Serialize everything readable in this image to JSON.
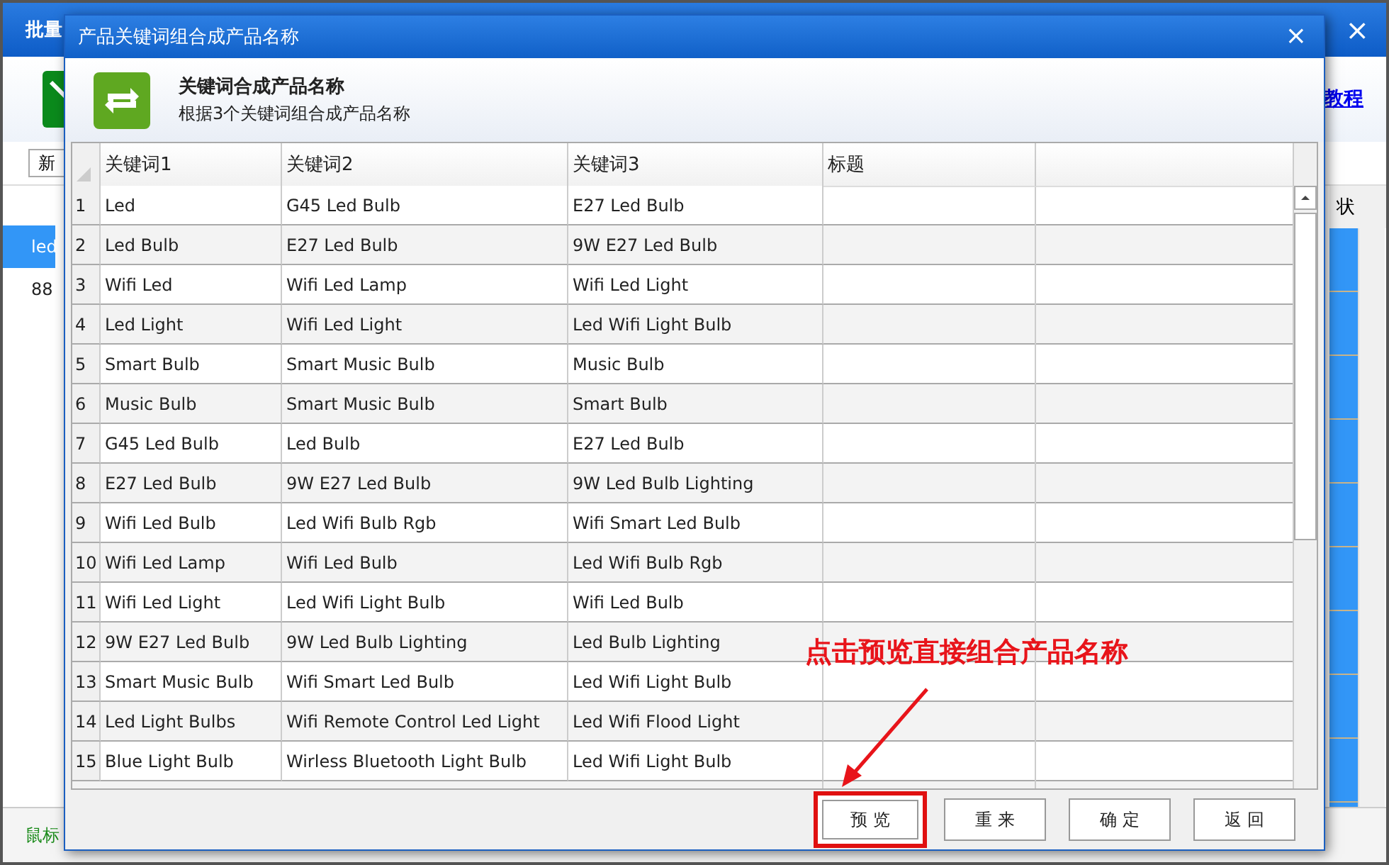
{
  "background_window": {
    "title": "批量",
    "close": "×",
    "toolbar_link": "教程",
    "search_value": "新",
    "list_items": [
      {
        "text": "led",
        "selected": true
      },
      {
        "text": "88",
        "selected": false
      }
    ],
    "table_column": "状",
    "status_text": "鼠标"
  },
  "dialog": {
    "title": "产品关键词组合成产品名称",
    "close": "×",
    "header_title": "关键词合成产品名称",
    "header_subtitle": "根据3个关键词组合成产品名称",
    "columns": [
      "关键词1",
      "关键词2",
      "关键词3",
      "标题"
    ],
    "rows": [
      {
        "number": "1",
        "cells": [
          "Led",
          "G45 Led Bulb",
          "E27 Led Bulb"
        ]
      },
      {
        "number": "2",
        "cells": [
          "Led Bulb",
          "E27 Led Bulb",
          "9W E27 Led Bulb"
        ]
      },
      {
        "number": "3",
        "cells": [
          "Wifi Led",
          "Wifi Led Lamp",
          "Wifi Led Light"
        ]
      },
      {
        "number": "4",
        "cells": [
          "Led Light",
          "Wifi Led Light",
          "Led Wifi Light Bulb"
        ]
      },
      {
        "number": "5",
        "cells": [
          "Smart Bulb",
          "Smart Music Bulb",
          "Music Bulb"
        ]
      },
      {
        "number": "6",
        "cells": [
          "Music Bulb",
          "Smart Music Bulb",
          "Smart Bulb"
        ]
      },
      {
        "number": "7",
        "cells": [
          "G45 Led Bulb",
          "Led Bulb",
          "E27 Led Bulb"
        ]
      },
      {
        "number": "8",
        "cells": [
          "E27 Led Bulb",
          "9W E27 Led Bulb",
          "9W Led Bulb Lighting"
        ]
      },
      {
        "number": "9",
        "cells": [
          "Wifi Led Bulb",
          "Led Wifi Bulb Rgb",
          "Wifi Smart Led Bulb"
        ]
      },
      {
        "number": "10",
        "cells": [
          "Wifi Led Lamp",
          "Wifi Led Bulb",
          "Led Wifi Bulb Rgb"
        ]
      },
      {
        "number": "11",
        "cells": [
          "Wifi Led Light",
          "Led Wifi Light Bulb",
          "Wifi Led Bulb"
        ]
      },
      {
        "number": "12",
        "cells": [
          "9W E27 Led Bulb",
          "9W Led Bulb Lighting",
          "Led Bulb Lighting"
        ]
      },
      {
        "number": "13",
        "cells": [
          "Smart Music Bulb",
          "Wifi Smart Led Bulb",
          "Led Wifi Light Bulb"
        ]
      },
      {
        "number": "14",
        "cells": [
          "Led Light Bulbs",
          "Wifi Remote Control Led Light",
          "Led Wifi Flood Light"
        ]
      },
      {
        "number": "15",
        "cells": [
          "Blue Light Bulb",
          "Wirless Bluetooth Light Bulb",
          "Led Wifi Light Bulb"
        ]
      }
    ],
    "buttons": [
      {
        "label": "预 览",
        "highlighted": true
      },
      {
        "label": "重 来",
        "highlighted": false
      },
      {
        "label": "确 定",
        "highlighted": false
      },
      {
        "label": "返 回",
        "highlighted": false
      }
    ]
  },
  "annotation": {
    "text": "点击预览直接组合产品名称"
  }
}
